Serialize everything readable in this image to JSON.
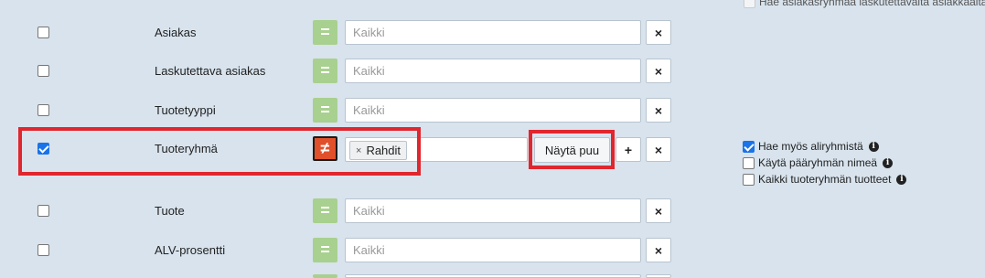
{
  "top_option": {
    "label": "Hae asiakasryhmää laskutettavalta asiakkaalta"
  },
  "rows": [
    {
      "label": "Asiakas",
      "operator": "=",
      "placeholder": "Kaikki",
      "checked": false
    },
    {
      "label": "Laskutettava asiakas",
      "operator": "=",
      "placeholder": "Kaikki",
      "checked": false
    },
    {
      "label": "Tuotetyyppi",
      "operator": "=",
      "placeholder": "Kaikki",
      "checked": false
    },
    {
      "label": "Tuoteryhmä",
      "operator": "≠",
      "tag": "Rahdit",
      "tag_remove": "×",
      "show_tree": "Näytä puu",
      "checked": true
    },
    {
      "label": "Tuote",
      "operator": "=",
      "placeholder": "Kaikki",
      "checked": false
    },
    {
      "label": "ALV-prosentti",
      "operator": "=",
      "placeholder": "Kaikki",
      "checked": false
    }
  ],
  "group_options": [
    {
      "label": "Hae myös aliryhmistä",
      "checked": true
    },
    {
      "label": "Käytä pääryhmän nimeä",
      "checked": false
    },
    {
      "label": "Kaikki tuoteryhmän tuotteet",
      "checked": false
    }
  ],
  "icons": {
    "clear": "×",
    "add": "+",
    "info": "i"
  },
  "colors": {
    "operator_eq": "#a8d08f",
    "operator_neq": "#e0502a",
    "highlight": "#e0262e",
    "checkbox": "#1a73e8"
  }
}
